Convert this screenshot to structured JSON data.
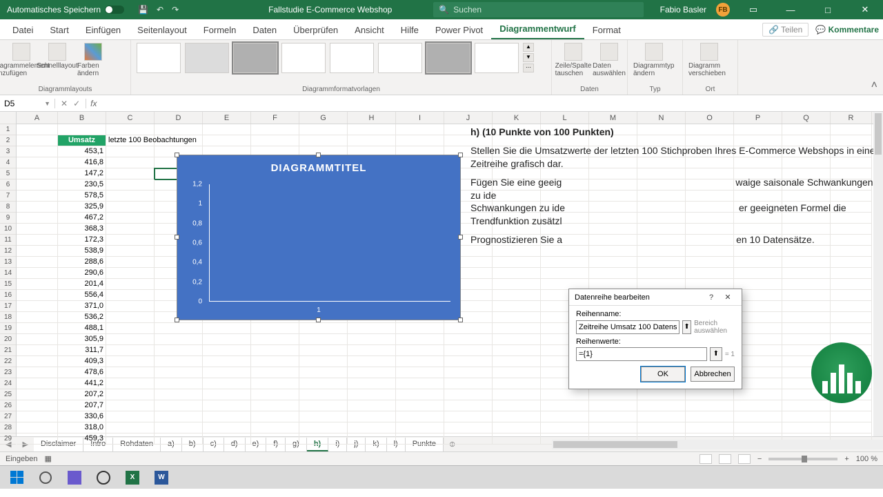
{
  "titlebar": {
    "autosave": "Automatisches Speichern",
    "doc": "Fallstudie E-Commerce Webshop",
    "search_placeholder": "Suchen",
    "user": "Fabio Basler",
    "initials": "FB"
  },
  "tabs": [
    "Datei",
    "Start",
    "Einfügen",
    "Seitenlayout",
    "Formeln",
    "Daten",
    "Überprüfen",
    "Ansicht",
    "Hilfe",
    "Power Pivot",
    "Diagrammentwurf",
    "Format"
  ],
  "active_tab": "Diagrammentwurf",
  "tab_actions": {
    "share": "Teilen",
    "comments": "Kommentare"
  },
  "ribbon": {
    "groups": [
      {
        "label": "Diagrammlayouts",
        "buttons": [
          "Diagrammelement hinzufügen",
          "Schnelllayout",
          "Farben ändern"
        ]
      },
      {
        "label": "Diagrammformatvorlagen"
      },
      {
        "label": "Daten",
        "buttons": [
          "Zeile/Spalte tauschen",
          "Daten auswählen"
        ]
      },
      {
        "label": "Typ",
        "buttons": [
          "Diagrammtyp ändern"
        ]
      },
      {
        "label": "Ort",
        "buttons": [
          "Diagramm verschieben"
        ]
      }
    ]
  },
  "fbar": {
    "name": "D5",
    "formula": ""
  },
  "columns": [
    "A",
    "B",
    "C",
    "D",
    "E",
    "F",
    "G",
    "H",
    "I",
    "J",
    "K",
    "L",
    "M",
    "N",
    "O",
    "P",
    "Q",
    "R"
  ],
  "grid": {
    "b2": "Umsatz",
    "c2": "letzte 100 Beobachtungen",
    "values": [
      "453,1",
      "416,8",
      "147,2",
      "230,5",
      "578,5",
      "325,9",
      "467,2",
      "368,3",
      "172,3",
      "538,9",
      "288,6",
      "290,6",
      "201,4",
      "556,4",
      "371,0",
      "536,2",
      "488,1",
      "305,9",
      "311,7",
      "409,3",
      "478,6",
      "441,2",
      "207,2",
      "207,7",
      "330,6",
      "318,0",
      "459,3"
    ]
  },
  "chart_data": {
    "type": "bar",
    "title": "DIAGRAMMTITEL",
    "categories": [
      "1"
    ],
    "values": [
      0
    ],
    "y_ticks": [
      "0",
      "0,2",
      "0,4",
      "0,6",
      "0,8",
      "1",
      "1,2"
    ],
    "ylim": [
      0,
      1.2
    ]
  },
  "textblock": {
    "heading": "h) (10 Punkte von 100 Punkten)",
    "p1": "Stellen Sie die Umsatzwerte der letzten 100 Stichproben Ihres E-Commerce Webshops in einer Zeitreihe grafisch dar.",
    "p2a": "Fügen Sie eine geeig",
    "p2b": "waige saisonale Schwankungen zu ide",
    "p2c": "er geeigneten Formel die Trendfunktion zusätzl",
    "p3a": "Prognostizieren Sie a",
    "p3b": "en 10 Datensätze."
  },
  "dialog": {
    "title": "Datenreihe bearbeiten",
    "label_name": "Reihenname:",
    "value_name": "Zeitreihe Umsatz 100 Datensätze",
    "hint_name": "Bereich auswählen",
    "label_values": "Reihenwerte:",
    "value_values": "={1}",
    "hint_values": "= 1",
    "ok": "OK",
    "cancel": "Abbrechen"
  },
  "sheets": [
    "Disclaimer",
    "Intro",
    "Rohdaten",
    "a)",
    "b)",
    "c)",
    "d)",
    "e)",
    "f)",
    "g)",
    "h)",
    "i)",
    "j)",
    "k)",
    "l)",
    "Punkte"
  ],
  "active_sheet": "h)",
  "status": {
    "mode": "Eingeben",
    "zoom": "100 %"
  }
}
